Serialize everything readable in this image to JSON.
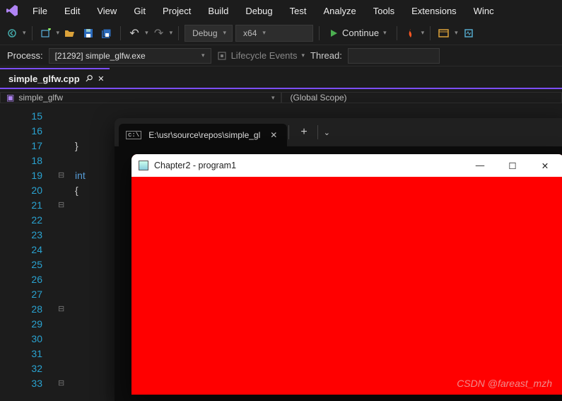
{
  "menubar": [
    "File",
    "Edit",
    "View",
    "Git",
    "Project",
    "Build",
    "Debug",
    "Test",
    "Analyze",
    "Tools",
    "Extensions",
    "Winc"
  ],
  "toolbar": {
    "config_label": "Debug",
    "platform_label": "x64",
    "continue_label": "Continue"
  },
  "debugbar": {
    "process_label": "Process:",
    "process_value": "[21292] simple_glfw.exe",
    "lifecycle_label": "Lifecycle Events",
    "thread_label": "Thread:"
  },
  "tab": {
    "filename": "simple_glfw.cpp",
    "close_glyph": "✕"
  },
  "scope": {
    "project_icon": "▣",
    "project_name": "simple_glfw",
    "global_scope": "(Global Scope)"
  },
  "editor": {
    "line_start": 15,
    "line_end": 33,
    "lines": {
      "15": "",
      "16": "",
      "17": "}",
      "18": "",
      "19": "int",
      "20": "{",
      "21": "",
      "22": "",
      "23": "",
      "24": "",
      "25": "",
      "26": "",
      "27": "",
      "28": "",
      "29": "",
      "30": "",
      "31": "",
      "32": "",
      "33": ""
    },
    "fold_minus_lines": [
      19,
      21,
      28,
      33
    ],
    "keyword": "int"
  },
  "terminal": {
    "tab_title": "E:\\usr\\source\\repos\\simple_gl",
    "close_glyph": "✕",
    "add_glyph": "+",
    "chev_glyph": "⌄"
  },
  "appwin": {
    "title": "Chapter2 - program1",
    "min_glyph": "—",
    "max_glyph": "☐",
    "close_glyph": "✕",
    "canvas_color": "#ff0000"
  },
  "watermark": "CSDN @fareast_mzh"
}
